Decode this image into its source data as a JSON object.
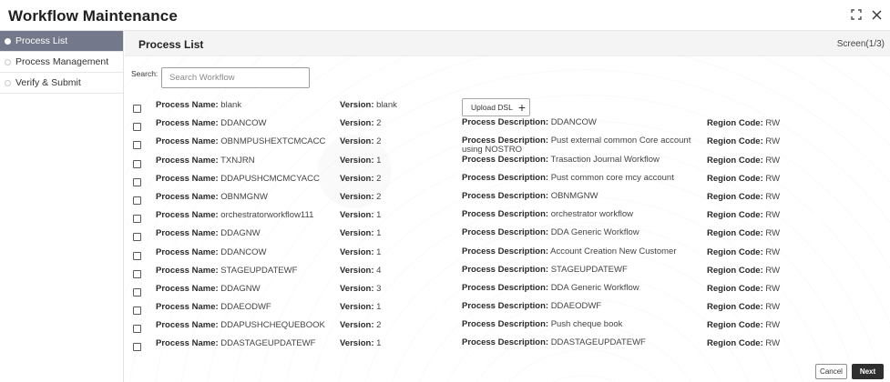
{
  "app": {
    "title": "Workflow Maintenance"
  },
  "window_controls": {
    "expand_icon": "expand-arrows-icon",
    "close_glyph": "×"
  },
  "sidebar": {
    "items": [
      {
        "label": "Process List",
        "active": true
      },
      {
        "label": "Process Management",
        "active": false
      },
      {
        "label": "Verify & Submit",
        "active": false
      }
    ]
  },
  "main": {
    "title": "Process List",
    "screen": "Screen(1/3)",
    "search": {
      "label": "Search:",
      "placeholder": "Search Workflow",
      "value": ""
    },
    "upload_label": "Upload DSL",
    "field_labels": {
      "name": "Process Name:",
      "version": "Version:",
      "description": "Process Description:",
      "region": "Region Code:"
    },
    "rows": [
      {
        "name": "blank",
        "version": "blank",
        "description": "",
        "region": ""
      },
      {
        "name": "DDANCOW",
        "version": "2",
        "description": "DDANCOW",
        "region": "RW"
      },
      {
        "name": "OBNMPUSHEXTCMCACC",
        "version": "2",
        "description": "Pust external common Core account using NOSTRO",
        "region": "RW"
      },
      {
        "name": "TXNJRN",
        "version": "1",
        "description": "Trasaction Journal Workflow",
        "region": "RW"
      },
      {
        "name": "DDAPUSHCMCMCYACC",
        "version": "2",
        "description": "Pust common core mcy account",
        "region": "RW"
      },
      {
        "name": "OBNMGNW",
        "version": "2",
        "description": "OBNMGNW",
        "region": "RW"
      },
      {
        "name": "orchestratorworkflow111",
        "version": "1",
        "description": "orchestrator workflow",
        "region": "RW"
      },
      {
        "name": "DDAGNW",
        "version": "1",
        "description": "DDA Generic Workflow",
        "region": "RW"
      },
      {
        "name": "DDANCOW",
        "version": "1",
        "description": "Account Creation New Customer",
        "region": "RW"
      },
      {
        "name": "STAGEUPDATEWF",
        "version": "4",
        "description": "STAGEUPDATEWF",
        "region": "RW"
      },
      {
        "name": "DDAGNW",
        "version": "3",
        "description": "DDA Generic Workflow",
        "region": "RW"
      },
      {
        "name": "DDAEODWF",
        "version": "1",
        "description": "DDAEODWF",
        "region": "RW"
      },
      {
        "name": "DDAPUSHCHEQUEBOOK",
        "version": "2",
        "description": "Push cheque book",
        "region": "RW"
      },
      {
        "name": "DDASTAGEUPDATEWF",
        "version": "1",
        "description": "DDASTAGEUPDATEWF",
        "region": "RW"
      }
    ]
  },
  "footer": {
    "cancel_label": "Cancel",
    "next_label": "Next"
  },
  "colors": {
    "sidebar_active": "#73798a",
    "next_button": "#2f2f2f"
  }
}
